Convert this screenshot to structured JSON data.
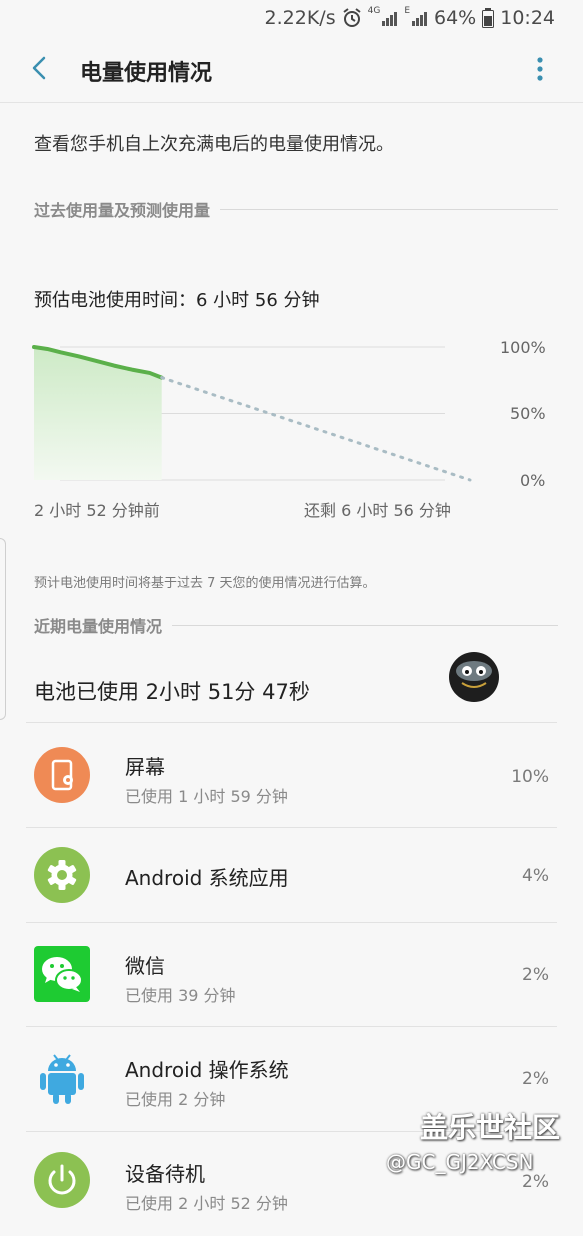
{
  "status_bar": {
    "speed": "2.22K/s",
    "net1": "4G",
    "net2": "E",
    "battery": "64%",
    "time": "10:24"
  },
  "app_bar": {
    "title": "电量使用情况"
  },
  "intro": "查看您手机自上次充满电后的电量使用情况。",
  "section1": "过去使用量及预测使用量",
  "estimate": "预估电池使用时间：6 小时 56 分钟",
  "chart_data": {
    "type": "line",
    "y_ticks": [
      "100%",
      "50%",
      "0%"
    ],
    "ylim": [
      0,
      100
    ],
    "x_labels": [
      "2 小时 52 分钟前",
      "还剩 6 小时 56 分钟"
    ],
    "past": {
      "name": "过去使用量",
      "x_hours": [
        0,
        0.3,
        0.6,
        1.0,
        1.4,
        1.8,
        2.2,
        2.6,
        2.87
      ],
      "y_percent": [
        100,
        98.5,
        96,
        93,
        89.5,
        86,
        83,
        80.5,
        77
      ]
    },
    "predicted": {
      "name": "预测使用量",
      "x_hours": [
        2.87,
        9.8
      ],
      "y_percent": [
        77,
        0
      ]
    },
    "grid": true,
    "colors": {
      "past_line": "#5bb04a",
      "past_fill": "#d6eed1",
      "predicted": "#a9bcc4",
      "grid": "#dcdcdc"
    }
  },
  "note": "预计电池使用时间将基于过去 7 天您的使用情况进行估算。",
  "section2": "近期电量使用情况",
  "battery_used": "电池已使用 2小时 51分 47秒",
  "apps": [
    {
      "name": "屏幕",
      "sub": "已使用 1 小时 59 分钟",
      "pct": "10%",
      "icon": "screen-icon",
      "color": "#ef8a55"
    },
    {
      "name": "Android 系统应用",
      "sub": "",
      "pct": "4%",
      "icon": "gear-icon",
      "color": "#8cc152"
    },
    {
      "name": "微信",
      "sub": "已使用 39 分钟",
      "pct": "2%",
      "icon": "wechat-icon",
      "color": "#1ecb32"
    },
    {
      "name": "Android 操作系统",
      "sub": "已使用 2 分钟",
      "pct": "2%",
      "icon": "android-icon",
      "color": "#3fa9e0"
    },
    {
      "name": "设备待机",
      "sub": "已使用 2 小时 52 分钟",
      "pct": "2%",
      "icon": "power-icon",
      "color": "#8cc152"
    }
  ],
  "watermark": {
    "line1": "盖乐世社区",
    "line2": "@GC_GJ2XCSN"
  }
}
